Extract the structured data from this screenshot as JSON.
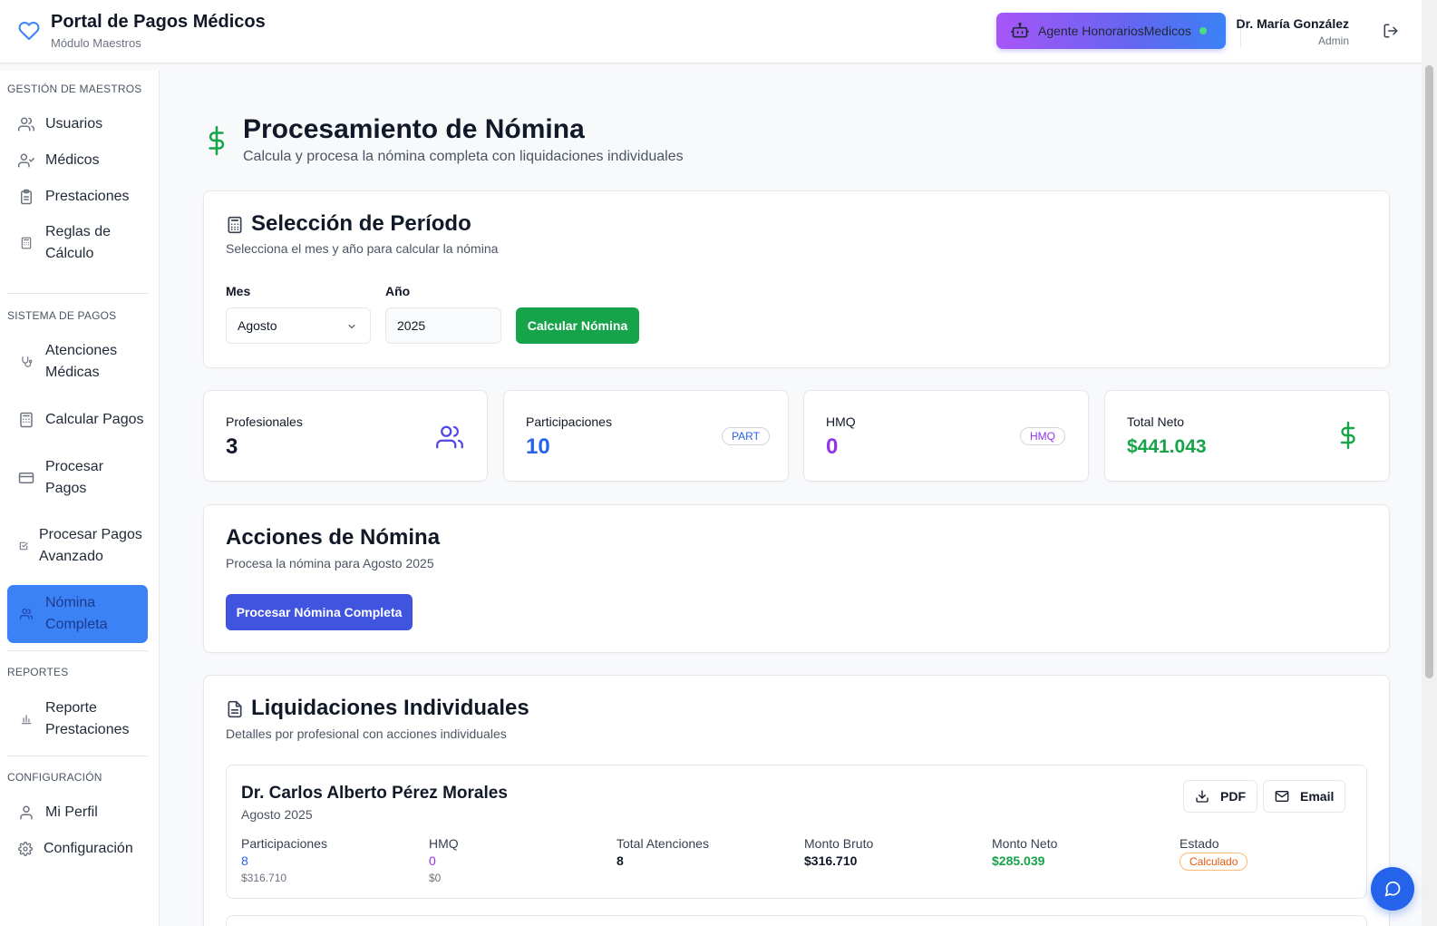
{
  "header": {
    "app_title": "Portal de Pagos Médicos",
    "app_subtitle": "Módulo Maestros",
    "agent_button": "Agente HonorariosMedicos",
    "user_name": "Dr. María González",
    "user_role": "Admin"
  },
  "sidebar": {
    "sections": [
      {
        "title": "GESTIÓN DE MAESTROS"
      },
      {
        "title": "SISTEMA DE PAGOS"
      },
      {
        "title": "REPORTES"
      },
      {
        "title": "CONFIGURACIÓN"
      }
    ],
    "items": [
      {
        "label": "Usuarios",
        "icon": "users-icon"
      },
      {
        "label": "Médicos",
        "icon": "user-check-icon"
      },
      {
        "label": "Prestaciones",
        "icon": "clipboard-icon"
      },
      {
        "label": "Reglas de Cálculo",
        "icon": "calculator-icon"
      },
      {
        "label": "Atenciones Médicas",
        "icon": "stethoscope-icon"
      },
      {
        "label": "Calcular Pagos",
        "icon": "calculator-icon"
      },
      {
        "label": "Procesar Pagos",
        "icon": "credit-card-icon"
      },
      {
        "label": "Procesar Pagos Avanzado",
        "icon": "check-square-icon"
      },
      {
        "label": "Nómina Completa",
        "icon": "users-icon",
        "active": true
      },
      {
        "label": "Reporte Prestaciones",
        "icon": "bar-chart-icon"
      },
      {
        "label": "Mi Perfil",
        "icon": "user-icon"
      },
      {
        "label": "Configuración",
        "icon": "gear-icon"
      }
    ]
  },
  "page": {
    "title": "Procesamiento de Nómina",
    "subtitle": "Calcula y procesa la nómina completa con liquidaciones individuales"
  },
  "period": {
    "title": "Selección de Período",
    "description": "Selecciona el mes y año para calcular la nómina",
    "month_label": "Mes",
    "month_value": "Agosto",
    "year_label": "Año",
    "year_value": "2025",
    "calc_button": "Calcular Nómina"
  },
  "stats": [
    {
      "label": "Profesionales",
      "value": "3",
      "color": "#111827"
    },
    {
      "label": "Participaciones",
      "value": "10",
      "badge": "PART",
      "color": "#2563eb"
    },
    {
      "label": "HMQ",
      "value": "0",
      "badge": "HMQ",
      "color": "#9333ea"
    },
    {
      "label": "Total Neto",
      "value": "$441.043",
      "color": "#16a34a"
    }
  ],
  "actions": {
    "title": "Acciones de Nómina",
    "description": "Procesa la nómina para Agosto 2025",
    "process_button": "Procesar Nómina Completa"
  },
  "liquidaciones": {
    "title": "Liquidaciones Individuales",
    "description": "Detalles por profesional con acciones individuales",
    "items": [
      {
        "name": "Dr. Carlos Alberto Pérez Morales",
        "period": "Agosto 2025",
        "pdf_button": "PDF",
        "email_button": "Email",
        "participaciones_label": "Participaciones",
        "participaciones_value": "8",
        "participaciones_amount": "$316.710",
        "hmq_label": "HMQ",
        "hmq_value": "0",
        "hmq_amount": "$0",
        "total_atenciones_label": "Total Atenciones",
        "total_atenciones_value": "8",
        "monto_bruto_label": "Monto Bruto",
        "monto_bruto_value": "$316.710",
        "monto_neto_label": "Monto Neto",
        "monto_neto_value": "$285.039",
        "estado_label": "Estado",
        "estado_value": "Calculado"
      }
    ]
  },
  "colors": {
    "accent_green": "#16a34a",
    "accent_blue": "#4054e0",
    "part_blue": "#2563eb",
    "hmq_purple": "#9333ea",
    "status_orange": "#ea580c"
  }
}
